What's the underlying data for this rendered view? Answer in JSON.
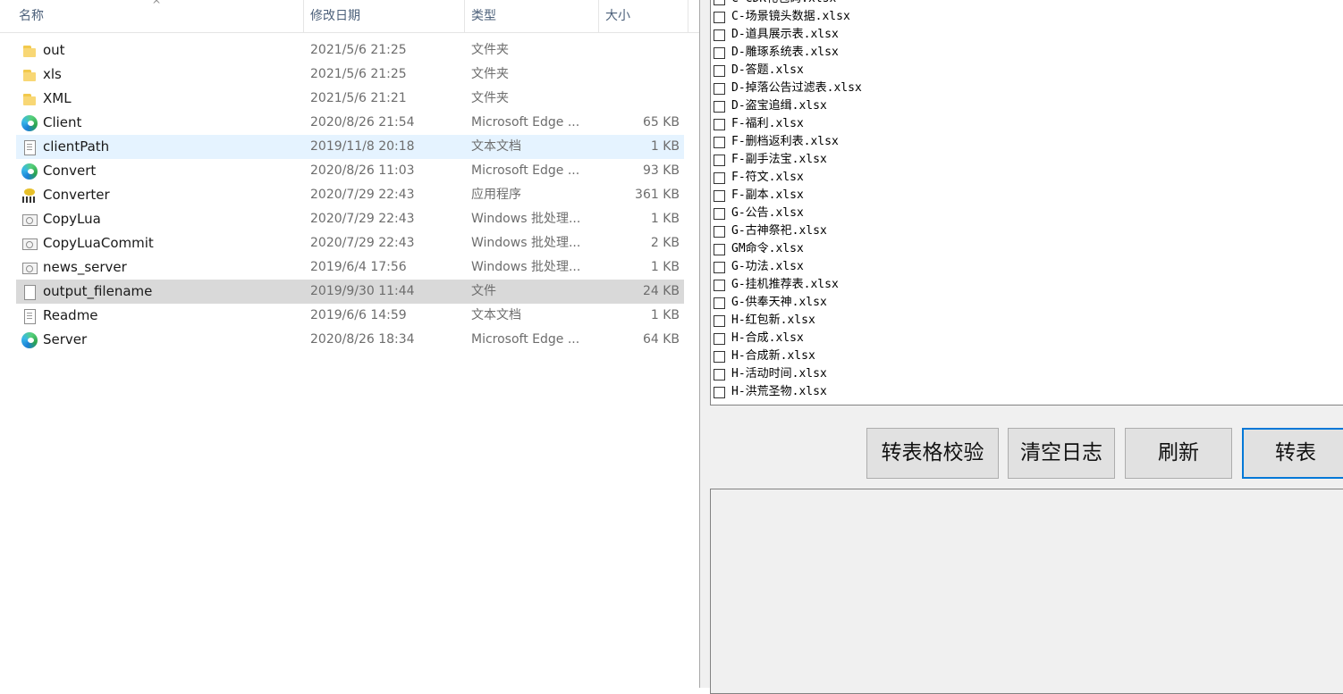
{
  "explorer": {
    "columns": {
      "name": "名称",
      "date": "修改日期",
      "type": "类型",
      "size": "大小"
    },
    "files": [
      {
        "name": "out",
        "date": "2021/5/6 21:25",
        "type": "文件夹",
        "size": "",
        "icon": "folder-icon"
      },
      {
        "name": "xls",
        "date": "2021/5/6 21:25",
        "type": "文件夹",
        "size": "",
        "icon": "folder-icon"
      },
      {
        "name": "XML",
        "date": "2021/5/6 21:21",
        "type": "文件夹",
        "size": "",
        "icon": "folder-icon"
      },
      {
        "name": "Client",
        "date": "2020/8/26 21:54",
        "type": "Microsoft Edge ...",
        "size": "65 KB",
        "icon": "edge-icon"
      },
      {
        "name": "clientPath",
        "date": "2019/11/8 20:18",
        "type": "文本文档",
        "size": "1 KB",
        "icon": "text-document-icon"
      },
      {
        "name": "Convert",
        "date": "2020/8/26 11:03",
        "type": "Microsoft Edge ...",
        "size": "93 KB",
        "icon": "edge-icon"
      },
      {
        "name": "Converter",
        "date": "2020/7/29 22:43",
        "type": "应用程序",
        "size": "361 KB",
        "icon": "application-icon"
      },
      {
        "name": "CopyLua",
        "date": "2020/7/29 22:43",
        "type": "Windows 批处理...",
        "size": "1 KB",
        "icon": "batch-file-icon"
      },
      {
        "name": "CopyLuaCommit",
        "date": "2020/7/29 22:43",
        "type": "Windows 批处理...",
        "size": "2 KB",
        "icon": "batch-file-icon"
      },
      {
        "name": "news_server",
        "date": "2019/6/4 17:56",
        "type": "Windows 批处理...",
        "size": "1 KB",
        "icon": "batch-file-icon"
      },
      {
        "name": "output_filename",
        "date": "2019/9/30 11:44",
        "type": "文件",
        "size": "24 KB",
        "icon": "file-icon"
      },
      {
        "name": "Readme",
        "date": "2019/6/6 14:59",
        "type": "文本文档",
        "size": "1 KB",
        "icon": "text-document-icon"
      },
      {
        "name": "Server",
        "date": "2020/8/26 18:34",
        "type": "Microsoft Edge ...",
        "size": "64 KB",
        "icon": "edge-icon"
      }
    ]
  },
  "tool": {
    "files": [
      "C-CDK礼包码.xlsx",
      "C-场景镜头数据.xlsx",
      "D-道具展示表.xlsx",
      "D-雕琢系统表.xlsx",
      "D-答题.xlsx",
      "D-掉落公告过滤表.xlsx",
      "D-盗宝追缉.xlsx",
      "F-福利.xlsx",
      "F-删档返利表.xlsx",
      "F-副手法宝.xlsx",
      "F-符文.xlsx",
      "F-副本.xlsx",
      "G-公告.xlsx",
      "G-古神祭祀.xlsx",
      "GM命令.xlsx",
      "G-功法.xlsx",
      "G-挂机推荐表.xlsx",
      "G-供奉天神.xlsx",
      "H-红包新.xlsx",
      "H-合成.xlsx",
      "H-合成新.xlsx",
      "H-活动时间.xlsx",
      "H-洪荒圣物.xlsx"
    ],
    "buttons": {
      "validate": "转表格校验",
      "clear_log": "清空日志",
      "refresh": "刷新",
      "convert": "转表"
    },
    "log_text": ""
  }
}
